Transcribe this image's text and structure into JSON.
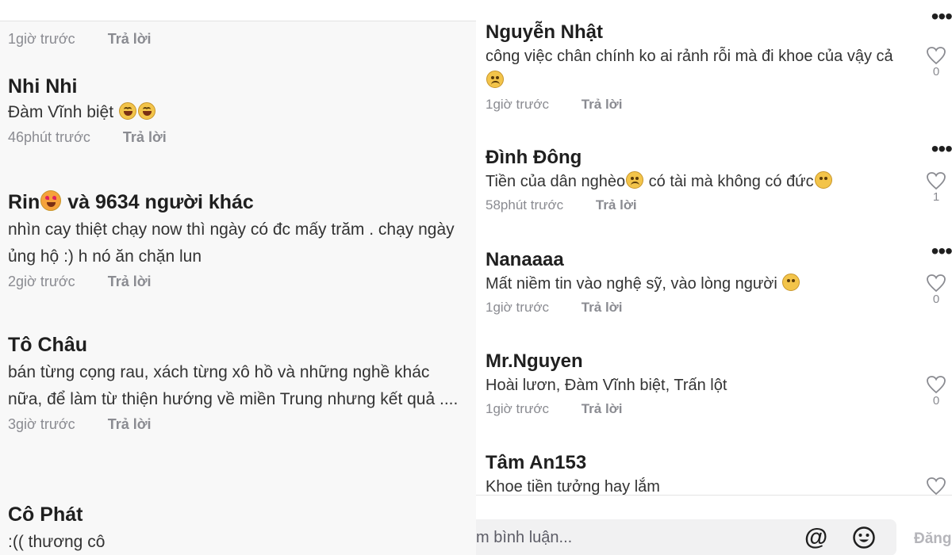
{
  "left": {
    "top_meta": {
      "time": "1giờ trước",
      "reply": "Trả lời"
    },
    "comments": [
      {
        "author": "Nhi Nhi",
        "text": "Đàm Vĩnh biệt",
        "time": "46phút trước",
        "reply": "Trả lời"
      },
      {
        "author": "Rin",
        "author_suffix": " và 9634 người khác",
        "text": "nhìn cay thiệt chạy now thì ngày có đc mấy trăm . chạy ngày ủng hộ :) h nó ăn chặn lun",
        "time": "2giờ trước",
        "reply": "Trả lời"
      },
      {
        "author": "Tô Châu",
        "text": "bán từng cọng rau, xách từng xô hồ và những nghề khác nữa, để làm từ thiện hướng về miền Trung nhưng kết quả ....",
        "time": "3giờ trước",
        "reply": "Trả lời"
      },
      {
        "author": "Cô Phát",
        "text": ":(( thương cô"
      }
    ]
  },
  "right": {
    "comments": [
      {
        "author": "Nguyễn Nhật",
        "text": "công việc chân chính ko ai rảnh rỗi mà đi khoe của vậy cả",
        "time": "1giờ trước",
        "reply": "Trả lời",
        "likes": "0"
      },
      {
        "author": "Đình Đông",
        "text": "Tiền của dân nghèo",
        "text2": " có tài mà không có đức",
        "time": "58phút trước",
        "reply": "Trả lời",
        "likes": "1"
      },
      {
        "author": "Nanaaaa",
        "text": "Mất niềm tin vào nghệ sỹ, vào lòng người",
        "time": "1giờ trước",
        "reply": "Trả lời",
        "likes": "0"
      },
      {
        "author": "Mr.Nguyen",
        "text": "Hoài lươn, Đàm Vĩnh biệt, Trấn lột",
        "time": "1giờ trước",
        "reply": "Trả lời",
        "likes": "0"
      },
      {
        "author": "Tâm An153",
        "text": "Khoe tiền tưởng hay lắm"
      }
    ]
  },
  "input": {
    "placeholder": "m bình luận...",
    "at_symbol": "@",
    "post_label": "Đăng"
  },
  "icons": {
    "heart": "heart-outline-icon",
    "more": "more-dots-icon",
    "emoji": "emoji-face-icon",
    "at": "at-mention-icon"
  }
}
